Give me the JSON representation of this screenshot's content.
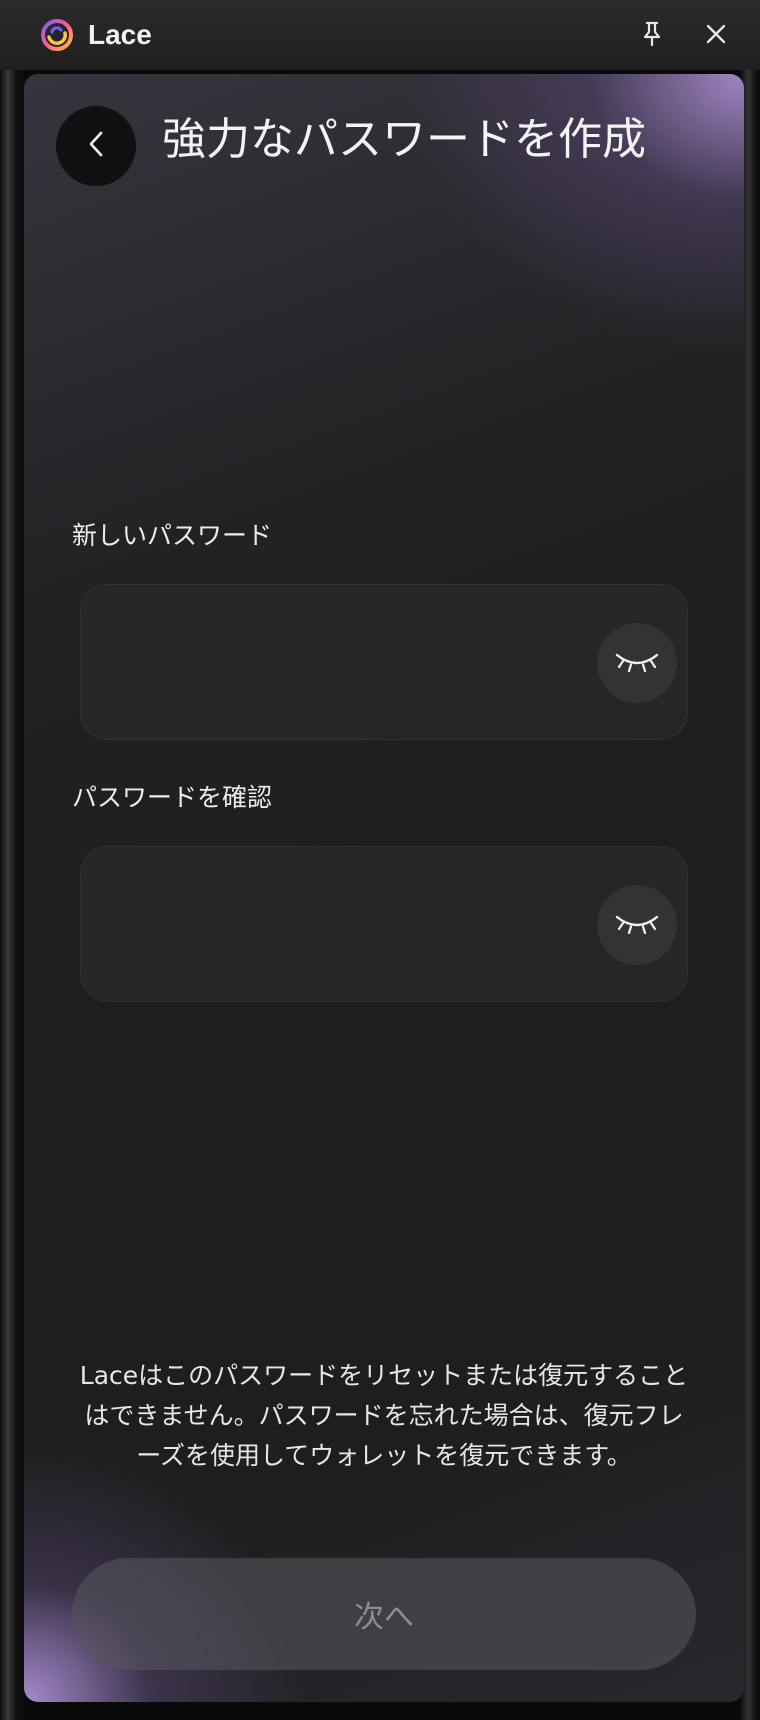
{
  "window": {
    "app_name": "Lace",
    "logo_icon": "lace-logo-icon",
    "pin_icon": "pin-icon",
    "close_icon": "close-icon"
  },
  "header": {
    "back_icon": "chevron-left-icon",
    "title": "強力なパスワードを作成"
  },
  "form": {
    "new_password": {
      "label": "新しいパスワード",
      "value": "",
      "toggle_icon": "eye-closed-icon"
    },
    "confirm_password": {
      "label": "パスワードを確認",
      "value": "",
      "toggle_icon": "eye-closed-icon"
    }
  },
  "notice": "Laceはこのパスワードをリセットまたは復元することはできません。パスワードを忘れた場合は、復元フレーズを使用してウォレットを復元できます。",
  "footer": {
    "next_label": "次へ",
    "next_disabled": true
  },
  "colors": {
    "accent": "#b49ae0",
    "panel": "#1e1e1e",
    "input": "#262626",
    "button_disabled": "#55535a"
  }
}
